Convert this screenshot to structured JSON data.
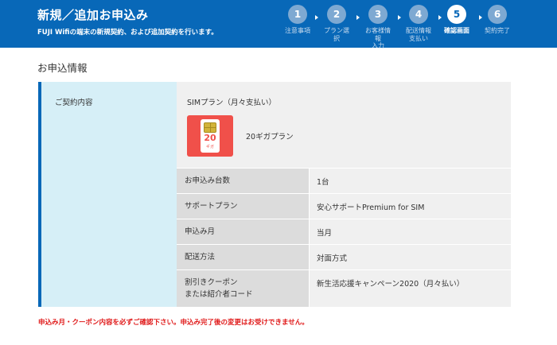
{
  "header": {
    "title": "新規／追加お申込み",
    "subtitle": "FUJI Wifiの端末の新規契約、および追加契約を行います。"
  },
  "steps": [
    {
      "number": "1",
      "label": "注意事項"
    },
    {
      "number": "2",
      "label": "プラン選\n択"
    },
    {
      "number": "3",
      "label": "お客様情\n報\n入力"
    },
    {
      "number": "4",
      "label": "配送情報\n支払い"
    },
    {
      "number": "5",
      "label": "確認画面",
      "active": true
    },
    {
      "number": "6",
      "label": "契約完了"
    }
  ],
  "section": {
    "title": "お申込情報"
  },
  "contract": {
    "label": "ご契約内容",
    "plan_name": "SIMプラン（月々支払い）",
    "sim_icon": "sim-card-icon",
    "sim_number": "20",
    "sim_unit": "ギガ",
    "plan_value": "20ギガプラン",
    "rows": [
      {
        "key": "お申込み台数",
        "value": "1台"
      },
      {
        "key": "サポートプラン",
        "value": "安心サポートPremium for SIM"
      },
      {
        "key": "申込み月",
        "value": "当月"
      },
      {
        "key": "配送方法",
        "value": "対面方式"
      },
      {
        "key": "割引きクーポン\nまたは紹介者コード",
        "value": "新生活応援キャンペーン2020（月々払い）"
      }
    ]
  },
  "notice": "申込み月・クーポン内容を必ずご確認下さい。申込み完了後の変更はお受けできません。",
  "colors": {
    "header_bg": "#0868b8",
    "label_bg": "#d6eff7",
    "notice": "#e01a1a",
    "sim_red": "#f0504a"
  }
}
